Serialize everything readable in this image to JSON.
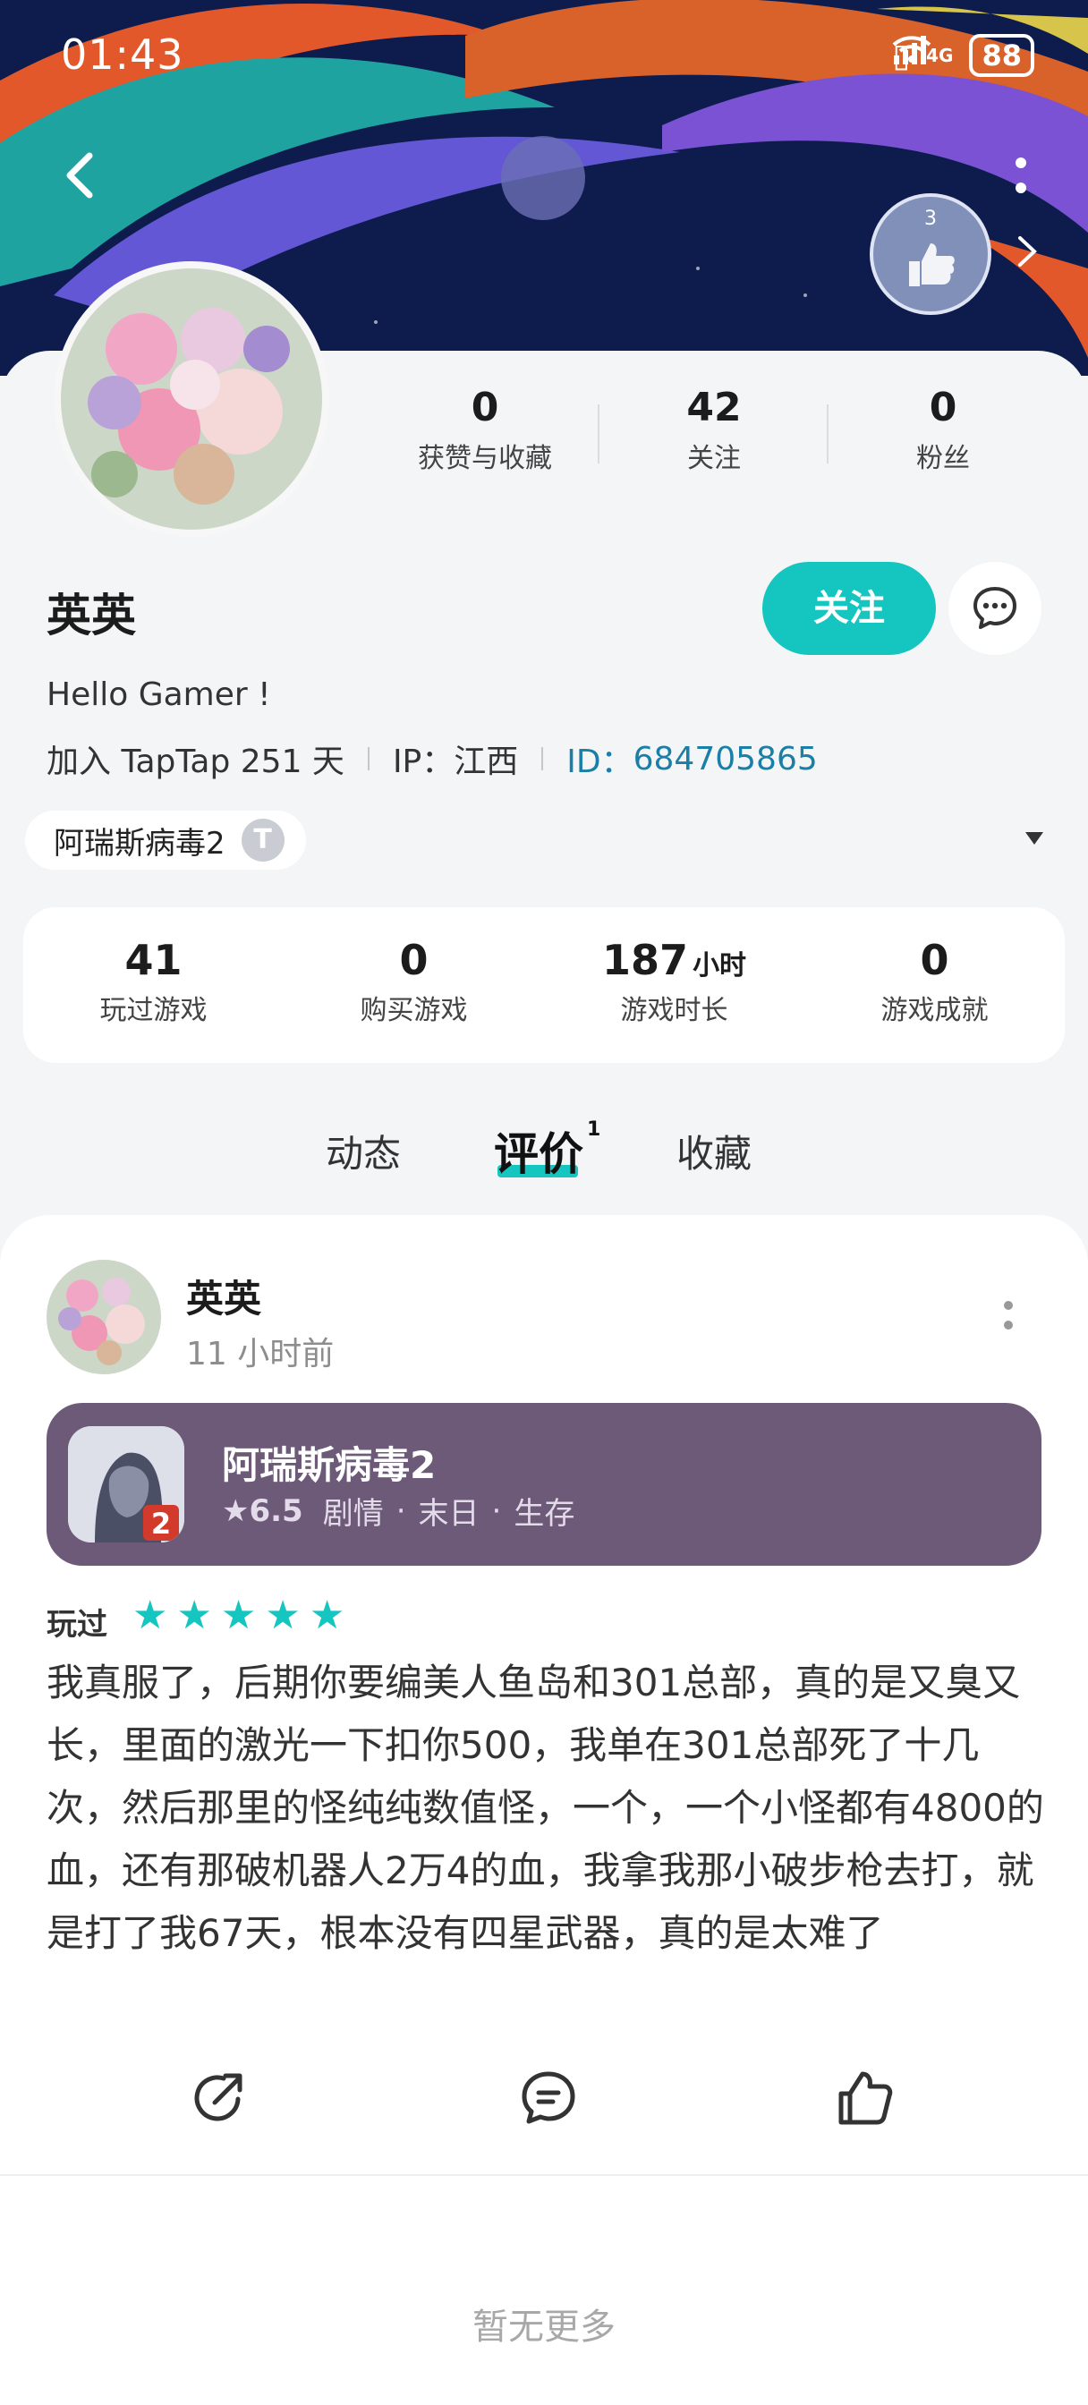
{
  "status_bar": {
    "time": "01:43",
    "network": "4G",
    "battery": "88"
  },
  "profile": {
    "username": "英英",
    "bio": "Hello Gamer !",
    "joined": "加入 TapTap 251 天",
    "ip": "IP：江西",
    "id_label": "ID：",
    "id_value": "684705865",
    "badge_number": "3",
    "follow_label": "关注",
    "stats": [
      {
        "value": "0",
        "label": "获赞与收藏"
      },
      {
        "value": "42",
        "label": "关注"
      },
      {
        "value": "0",
        "label": "粉丝"
      }
    ],
    "game_chip": "阿瑞斯病毒2",
    "game_chip_icon_letter": "T"
  },
  "game_stats": [
    {
      "value": "41",
      "unit": "",
      "label": "玩过游戏"
    },
    {
      "value": "0",
      "unit": "",
      "label": "购买游戏"
    },
    {
      "value": "187",
      "unit": "小时",
      "label": "游戏时长"
    },
    {
      "value": "0",
      "unit": "",
      "label": "游戏成就"
    }
  ],
  "tabs": [
    {
      "label": "动态",
      "count": ""
    },
    {
      "label": "评价",
      "count": "1"
    },
    {
      "label": "收藏",
      "count": ""
    }
  ],
  "review": {
    "author": "英英",
    "time": "11 小时前",
    "game_title": "阿瑞斯病毒2",
    "game_score": "6.5",
    "game_tags": [
      "剧情",
      "末日",
      "生存"
    ],
    "played_label": "玩过",
    "rating": 5,
    "text": "我真服了，后期你要编美人鱼岛和301总部，真的是又臭又长，里面的激光一下扣你500，我单在301总部死了十几次，然后那里的怪纯纯数值怪，一个，一个小怪都有4800的血，还有那破机器人2万4的血，我拿我那小破步枪去打，就是打了我67天，根本没有四星武器，真的是太难了"
  },
  "footer": {
    "no_more": "暂无更多"
  },
  "colors": {
    "accent": "#15c5c0",
    "game_card": "#6c5a78",
    "id_link": "#1a7fa8"
  },
  "icons": {
    "back": "back-arrow-icon",
    "more": "more-vertical-icon",
    "message": "message-icon",
    "share": "share-icon",
    "comment": "comment-icon",
    "like": "thumbs-up-icon"
  }
}
